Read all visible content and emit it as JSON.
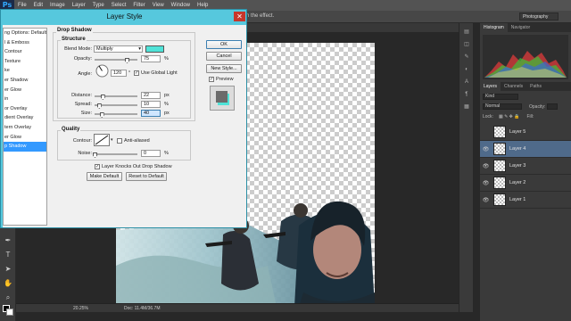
{
  "menubar": {
    "logo": "Ps",
    "items": [
      "File",
      "Edit",
      "Image",
      "Layer",
      "Type",
      "Select",
      "Filter",
      "View",
      "Window",
      "Help"
    ]
  },
  "optionsbar": {
    "hint": "n the effect.",
    "workspace": "Photography"
  },
  "dialog": {
    "title": "Layer Style",
    "styles": [
      "ng Options: Default",
      "l & Emboss",
      "Contour",
      "Texture",
      "ke",
      "er Shadow",
      "er Glow",
      "in",
      "or Overlay",
      "dient Overlay",
      "tern Overlay",
      "er Glow",
      "p Shadow"
    ],
    "selected_style_index": 12,
    "section_title": "Drop Shadow",
    "structure_label": "Structure",
    "blend_mode_label": "Blend Mode:",
    "blend_mode_value": "Multiply",
    "shadow_color": "#4fe3d8",
    "opacity_label": "Opacity:",
    "opacity_value": "75",
    "opacity_unit": "%",
    "opacity_level": 0.75,
    "angle_label": "Angle:",
    "angle_value": "120",
    "angle_unit": "°",
    "global_light_label": "Use Global Light",
    "global_light_checked": "✓",
    "distance_label": "Distance:",
    "distance_value": "22",
    "distance_unit": "px",
    "spread_label": "Spread:",
    "spread_value": "10",
    "spread_unit": "%",
    "size_label": "Size:",
    "size_value": "40",
    "size_unit": "px",
    "quality_label": "Quality",
    "contour_label": "Contour:",
    "anti_aliased_label": "Anti-aliased",
    "noise_label": "Noise:",
    "noise_value": "0",
    "noise_unit": "%",
    "knockout_label": "Layer Knocks Out Drop Shadow",
    "knockout_checked": "✓",
    "make_default_label": "Make Default",
    "reset_default_label": "Reset to Default",
    "ok_label": "OK",
    "cancel_label": "Cancel",
    "new_style_label": "New Style...",
    "preview_label": "Preview",
    "preview_checked": "✓"
  },
  "statusbar": {
    "zoom": "20.25%",
    "doc_size": "Doc: 11.4M/36.7M"
  },
  "panels": {
    "top_tabs": [
      "Histogram",
      "Navigator"
    ],
    "layer_tabs": [
      "Layers",
      "Channels",
      "Paths"
    ],
    "kind_label": "Kind",
    "blend_mode": "Normal",
    "opacity_label": "Opacity:",
    "lock_label": "Lock:",
    "fill_label": "Fill:",
    "layers": [
      {
        "name": "Layer 5",
        "visible": false
      },
      {
        "name": "Layer 4",
        "visible": true
      },
      {
        "name": "Layer 3",
        "visible": true
      },
      {
        "name": "Layer 2",
        "visible": true
      },
      {
        "name": "Layer 1",
        "visible": true
      }
    ],
    "selected_layer_index": 1
  },
  "colors": {
    "dialog_frame": "#56c8dd",
    "selection": "#3399ff",
    "shadow": "#4fe3d8",
    "ps_blue": "#31a8ff"
  }
}
